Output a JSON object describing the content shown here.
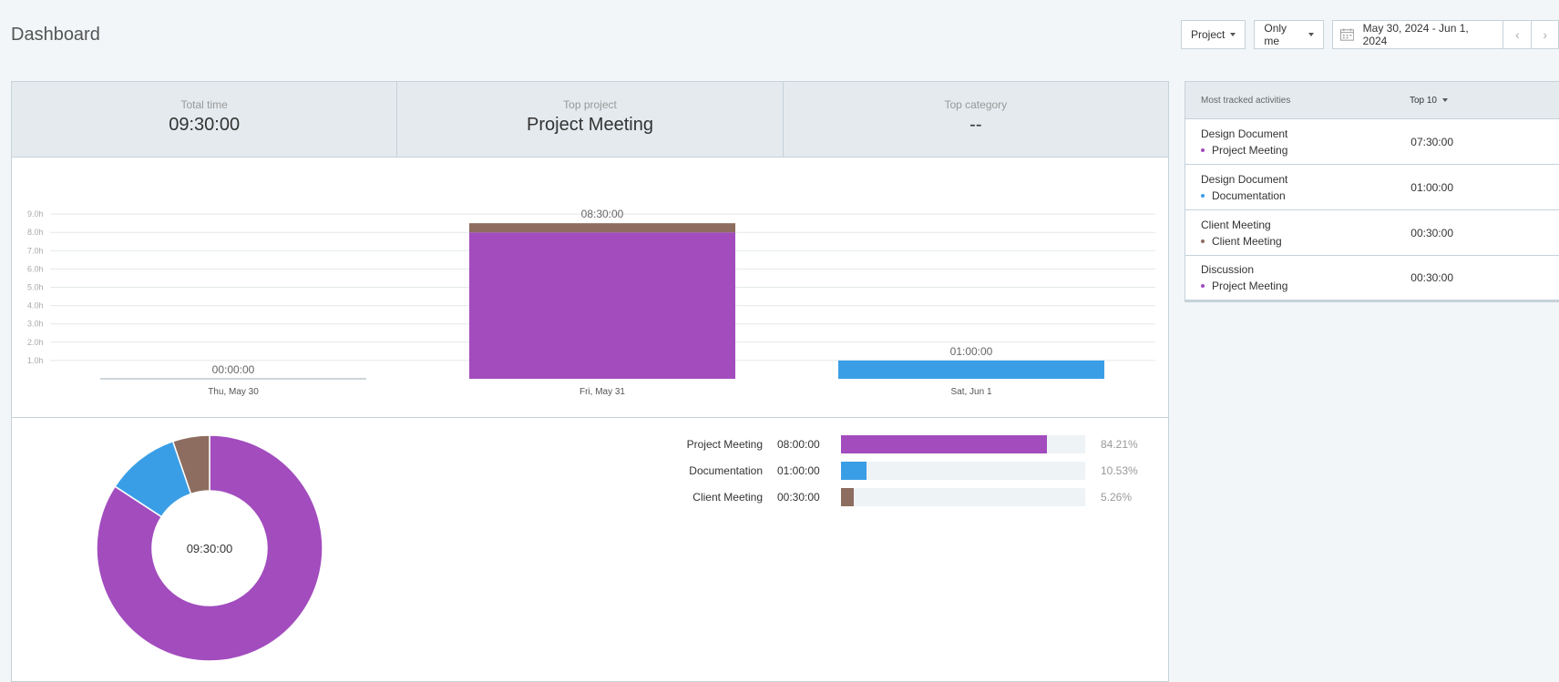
{
  "page": {
    "title": "Dashboard"
  },
  "toolbar": {
    "group_by": "Project",
    "user_filter": "Only me",
    "date_range": "May 30, 2024 - Jun 1, 2024",
    "prev_icon": "‹",
    "next_icon": "›"
  },
  "stats": [
    {
      "label": "Total time",
      "value": "09:30:00"
    },
    {
      "label": "Top project",
      "value": "Project Meeting"
    },
    {
      "label": "Top category",
      "value": "--"
    }
  ],
  "colors": {
    "project_meeting": "#a24cbe",
    "documentation": "#3a9ee6",
    "client_meeting": "#8d6d5f"
  },
  "chart_data": [
    {
      "type": "bar",
      "stacked": true,
      "categories": [
        "Thu, May 30",
        "Fri, May 31",
        "Sat, Jun 1"
      ],
      "totals": [
        "00:00:00",
        "08:30:00",
        "01:00:00"
      ],
      "y_ticks": [
        "1.0h",
        "2.0h",
        "3.0h",
        "4.0h",
        "5.0h",
        "6.0h",
        "7.0h",
        "8.0h",
        "9.0h"
      ],
      "ylim": [
        0,
        9
      ],
      "grid": true,
      "series": [
        {
          "key": "project_meeting",
          "values": [
            0,
            8.0,
            0
          ]
        },
        {
          "key": "client_meeting",
          "values": [
            0,
            0.5,
            0
          ]
        },
        {
          "key": "documentation",
          "values": [
            0,
            0,
            1.0
          ]
        }
      ]
    },
    {
      "type": "pie",
      "donut": true,
      "center_label": "09:30:00",
      "slices": [
        {
          "label": "Project Meeting",
          "value": 8.0,
          "key": "project_meeting"
        },
        {
          "label": "Documentation",
          "value": 1.0,
          "key": "documentation"
        },
        {
          "label": "Client Meeting",
          "value": 0.5,
          "key": "client_meeting"
        }
      ]
    }
  ],
  "breakdown": [
    {
      "name": "Project Meeting",
      "time": "08:00:00",
      "pct": "84.21%",
      "fraction": 0.8421,
      "key": "project_meeting"
    },
    {
      "name": "Documentation",
      "time": "01:00:00",
      "pct": "10.53%",
      "fraction": 0.1053,
      "key": "documentation"
    },
    {
      "name": "Client Meeting",
      "time": "00:30:00",
      "pct": "5.26%",
      "fraction": 0.0526,
      "key": "client_meeting"
    }
  ],
  "activities": {
    "header": "Most tracked activities",
    "top_selector": "Top 10",
    "items": [
      {
        "title": "Design Document",
        "project": "Project Meeting",
        "time": "07:30:00",
        "key": "project_meeting"
      },
      {
        "title": "Design Document",
        "project": "Documentation",
        "time": "01:00:00",
        "key": "documentation"
      },
      {
        "title": "Client Meeting",
        "project": "Client Meeting",
        "time": "00:30:00",
        "key": "client_meeting"
      },
      {
        "title": "Discussion",
        "project": "Project Meeting",
        "time": "00:30:00",
        "key": "project_meeting"
      }
    ]
  }
}
